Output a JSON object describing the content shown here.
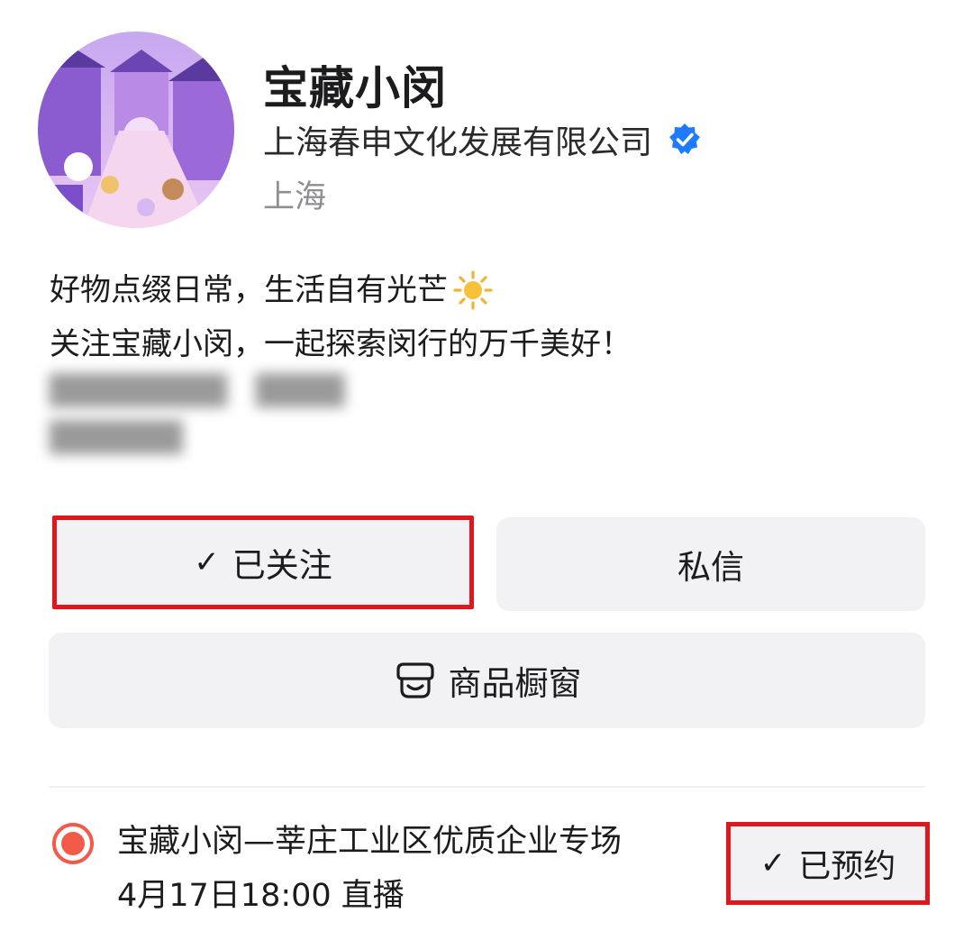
{
  "profile": {
    "name": "宝藏小闵",
    "company": "上海春申文化发展有限公司",
    "location": "上海",
    "verified_icon": "verified-badge-icon",
    "verified_color": "#1e7bff"
  },
  "bio": {
    "line1": "好物点缀日常，生活自有光芒",
    "line2": "关注宝藏小闵，一起探索闵行的万千美好！",
    "sun_icon": "sun-emoji-icon"
  },
  "actions": {
    "follow_check": "✓",
    "follow_label": "已关注",
    "message_label": "私信",
    "shop_label": "商品橱窗",
    "shop_icon": "shop-window-icon"
  },
  "live": {
    "icon": "live-record-icon",
    "title": "宝藏小闵—莘庄工业区优质企业专场",
    "time": "4月17日18:00 直播",
    "reserved_check": "✓",
    "reserved_label": "已预约"
  },
  "colors": {
    "highlight_border": "#e0181d",
    "live_dot": "#f25a4a",
    "button_bg": "#f2f2f4"
  }
}
